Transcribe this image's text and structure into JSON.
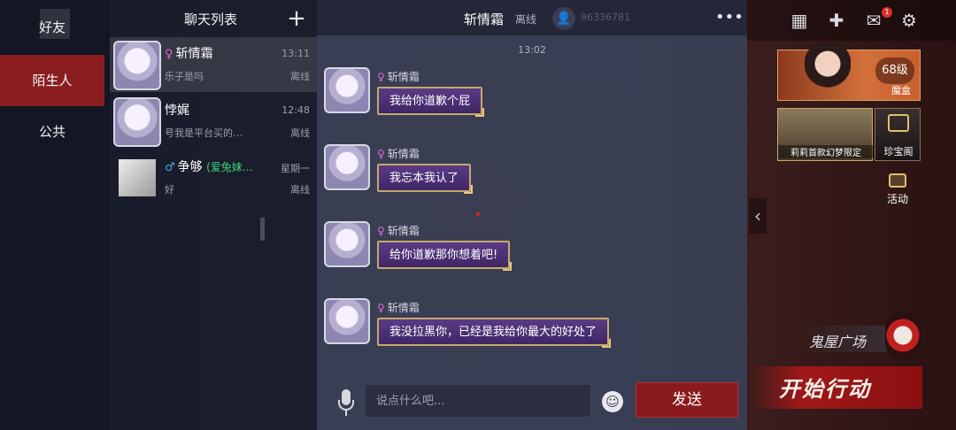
{
  "categories": [
    {
      "label": "好友",
      "active": false
    },
    {
      "label": "陌生人",
      "active": true
    },
    {
      "label": "公共",
      "active": false
    }
  ],
  "chat_list": {
    "title": "聊天列表",
    "add_icon": "plus-icon",
    "items": [
      {
        "name": "斩情霜",
        "gender": "female",
        "preview": "乐子是吗",
        "time": "13:11",
        "status": "离线",
        "active": true
      },
      {
        "name": "悖娓",
        "gender": "",
        "preview": "号我是平台买的…",
        "time": "12:48",
        "status": "离线",
        "active": false
      },
      {
        "name": "争够",
        "gender": "male",
        "note": "(爱兔妹…",
        "preview": "好",
        "time": "星期一",
        "status": "离线",
        "active": false
      }
    ]
  },
  "conversation": {
    "partner_name": "斩情霜",
    "partner_status": "离线",
    "header_ghost_text": "96336781",
    "add_friend_icon": "add-friend-icon",
    "more_icon": "more-icon",
    "timestamp": "13:02",
    "messages": [
      {
        "sender": "斩情霜",
        "text": "我给你道歉个屁"
      },
      {
        "sender": "斩情霜",
        "text": "我忘本我认了"
      },
      {
        "sender": "斩情霜",
        "text": "给你道歉那你想着吧!"
      },
      {
        "sender": "斩情霜",
        "text": "我没拉黑你，已经是我给你最大的好处了"
      }
    ],
    "input_placeholder": "说点什么吧...",
    "input_value": "",
    "send_label": "发送",
    "mic_icon": "microphone-icon",
    "emoji_icon": "emoji-icon"
  },
  "game_ui": {
    "mail_badge": "1",
    "level": "68级",
    "mohe_label": "魔盒",
    "promo_label": "莉莉首款幻梦限定",
    "treasure_label": "珍宝阁",
    "activity_label": "活动",
    "ghost_house_label": "鬼屋广场",
    "start_label": "开始行动"
  },
  "colors": {
    "send_button": "#8b1a1c",
    "stranger_tab": "#8a1e1e",
    "bubble": "#4a2d75",
    "bubble_border": "#c8a86a"
  }
}
